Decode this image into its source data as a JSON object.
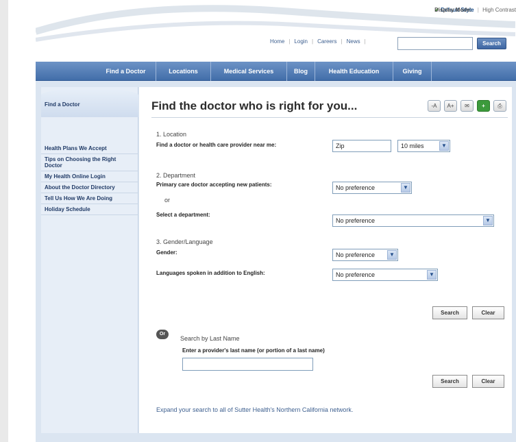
{
  "header": {
    "display_mode_label": "Display Mode:",
    "default_style": "Default Style",
    "high_contrast": "High Contrast",
    "utility_links": [
      "Home",
      "Login",
      "Careers",
      "News"
    ],
    "search_button": "Search"
  },
  "nav": {
    "items": [
      "Find a Doctor",
      "Locations",
      "Medical Services",
      "Blog",
      "Health Education",
      "Giving"
    ]
  },
  "sidebar": {
    "title": "Find a Doctor",
    "items": [
      "Health Plans We Accept",
      "Tips on Choosing the Right Doctor",
      "My Health Online Login",
      "About the Doctor Directory",
      "Tell Us How We Are Doing",
      "Holiday Schedule"
    ]
  },
  "main": {
    "title": "Find the doctor who is right for you...",
    "tools": [
      "-A",
      "A+"
    ],
    "location": {
      "section": "1. Location",
      "label": "Find a doctor or health care provider near me:",
      "zip_value": "Zip",
      "distance": "10 miles"
    },
    "department": {
      "section": "2. Department",
      "primary_label": "Primary care doctor accepting new patients:",
      "primary_value": "No preference",
      "or": "or",
      "select_label": "Select a department:",
      "select_value": "No preference"
    },
    "gender_language": {
      "section": "3. Gender/Language",
      "gender_label": "Gender:",
      "gender_value": "No preference",
      "language_label": "Languages spoken in addition to English:",
      "language_value": "No preference"
    },
    "buttons": {
      "search": "Search",
      "clear": "Clear"
    },
    "lastname": {
      "or_badge": "Or",
      "title": "Search by Last Name",
      "label": "Enter a provider's last name (or portion of a last name)",
      "value": ""
    },
    "expand_link": "Expand your search to all of Sutter Health's Northern California network."
  }
}
